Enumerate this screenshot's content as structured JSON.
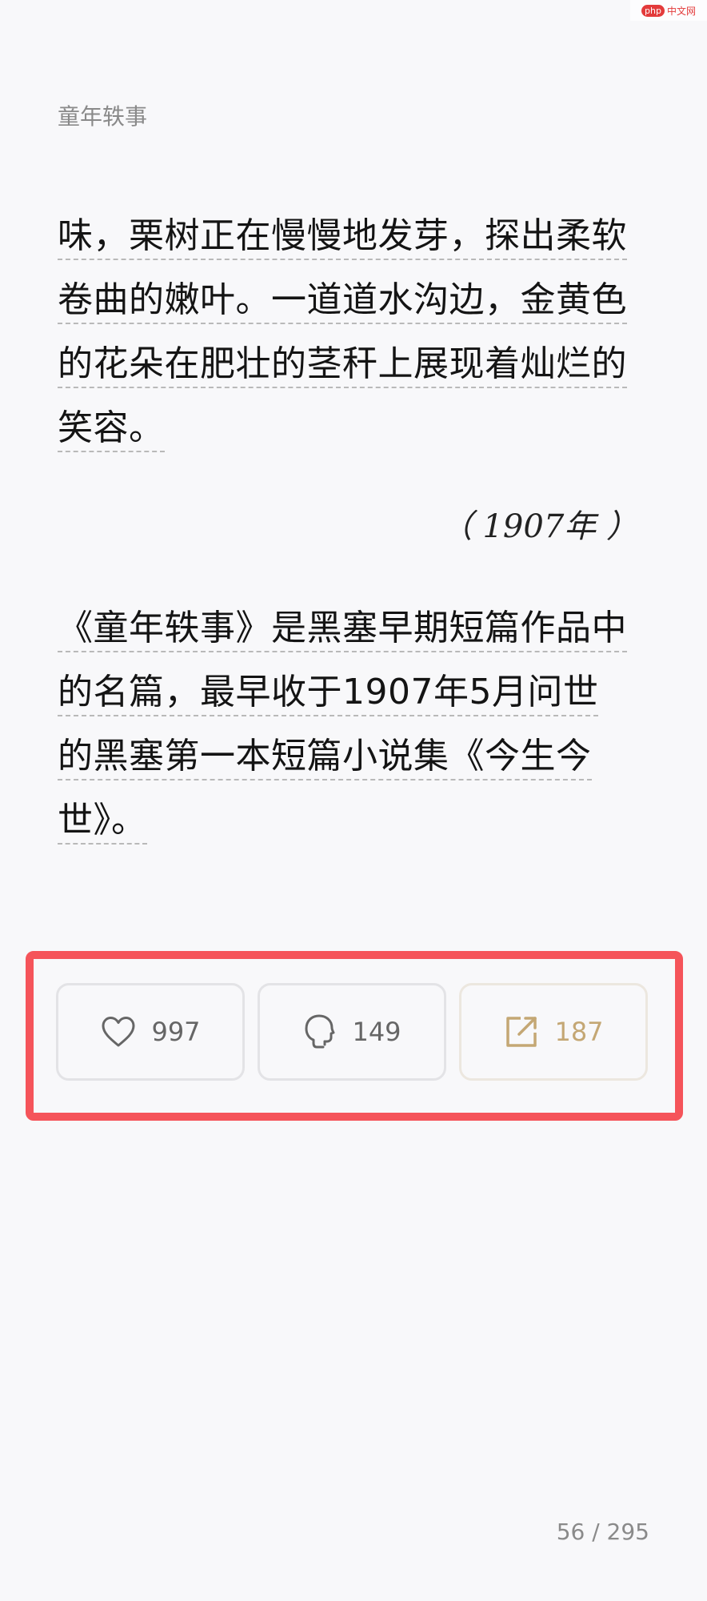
{
  "watermark": {
    "logo": "php",
    "text": "中文网"
  },
  "header": {
    "book_title": "童年轶事"
  },
  "content": {
    "paragraph1": [
      "味，栗树正在慢慢地发芽，探出柔软",
      "卷曲的嫩叶。一道道水沟边，金黄色",
      "的花朵在肥壮的茎秆上展现着灿烂的",
      "笑容。"
    ],
    "date_line": "（ 1907年 ）",
    "paragraph2": [
      "《童年轶事》是黑塞早期短篇作品中",
      "的名篇，最早收于1907年5月问世",
      "的黑塞第一本短篇小说集《今生今",
      "世》。"
    ]
  },
  "actions": {
    "like_count": "997",
    "comment_count": "149",
    "share_count": "187",
    "like_icon": "heart-icon",
    "comment_icon": "head-speech-icon",
    "share_icon": "share-external-icon",
    "highlight_color": "#f5545a",
    "share_color": "#c4a774"
  },
  "footer": {
    "page_indicator": "56 / 295"
  }
}
